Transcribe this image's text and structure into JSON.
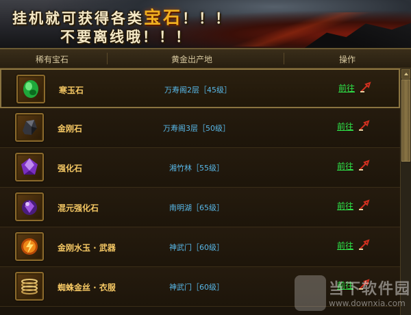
{
  "banner": {
    "line1_pre": "挂机就可获得各类",
    "line1_highlight": "宝石",
    "line1_post": "！！！",
    "line2": "不要离线哦！！！"
  },
  "table": {
    "columns": [
      "稀有宝石",
      "黄金出产地",
      "操作"
    ],
    "rows": [
      {
        "icon": "green-gem-icon",
        "name": "寒玉石",
        "location": "万寿阁2层［45级］",
        "action": "前往"
      },
      {
        "icon": "dark-stone-icon",
        "name": "金刚石",
        "location": "万寿阁3层［50级］",
        "action": "前往"
      },
      {
        "icon": "purple-crystal-icon",
        "name": "强化石",
        "location": "湘竹林［55级］",
        "action": "前往"
      },
      {
        "icon": "purple-orb-icon",
        "name": "混元强化石",
        "location": "南明湖［65级］",
        "action": "前往"
      },
      {
        "icon": "orange-flame-icon",
        "name": "金刚水玉 · 武器",
        "location": "神武门［60级］",
        "action": "前往"
      },
      {
        "icon": "silk-coil-icon",
        "name": "蜘蛛金丝 · 衣服",
        "location": "神武门［60级］",
        "action": "前往"
      }
    ]
  },
  "watermark": {
    "title": "当下软件园",
    "url": "www.downxia.com"
  },
  "colors": {
    "name": "#f5c864",
    "location": "#58b8e8",
    "action": "#2ee84a",
    "highlight": "#f0b020"
  }
}
